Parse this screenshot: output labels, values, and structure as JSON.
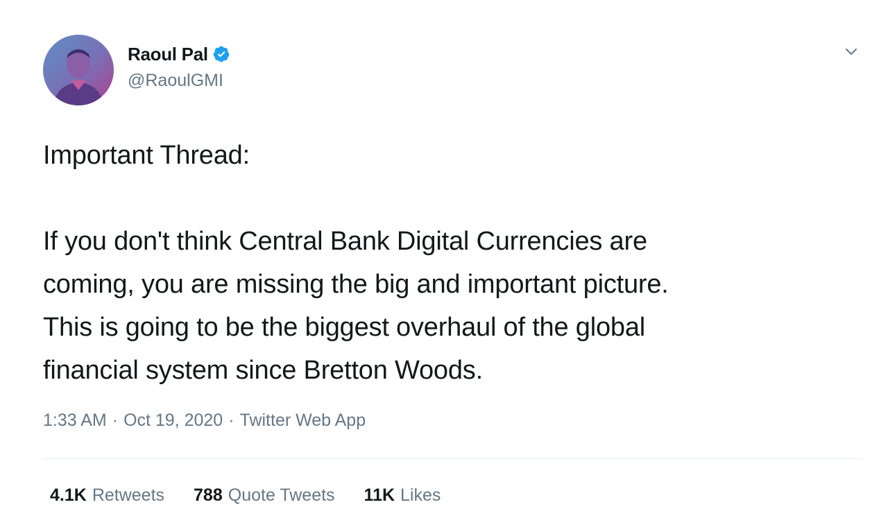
{
  "author": {
    "name": "Raoul Pal",
    "handle": "@RaoulGMI",
    "verified_icon": "verified-badge-icon",
    "avatar_colors": {
      "primary": "#5b6fb0",
      "accent": "#b0408a"
    }
  },
  "tweet": {
    "text": "Important Thread:\n\nIf you don't think Central Bank Digital Currencies are\ncoming, you are missing the big and important picture.\nThis is going to be the biggest overhaul of the global\nfinancial system since Bretton Woods.",
    "time": "1:33 AM",
    "date": "Oct 19, 2020",
    "separator": "·",
    "source": "Twitter Web App"
  },
  "stats": {
    "retweets": {
      "count": "4.1K",
      "label": "Retweets"
    },
    "quote_tweets": {
      "count": "788",
      "label": "Quote Tweets"
    },
    "likes": {
      "count": "11K",
      "label": "Likes"
    }
  },
  "menu": {
    "icon": "chevron-down-icon"
  },
  "colors": {
    "text": "#14171a",
    "muted": "#657786",
    "verified": "#1da1f2",
    "divider": "#e6ecf0"
  }
}
